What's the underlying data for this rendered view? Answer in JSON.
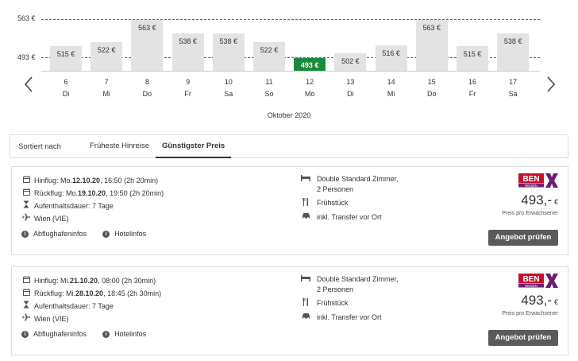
{
  "chart": {
    "y_labels": {
      "high": "563 €",
      "low": "493 €"
    },
    "month": "Oktober 2020",
    "selected_index": 6,
    "bars": [
      {
        "price_label": "515 €",
        "value": 515,
        "day": "6",
        "weekday": "Di"
      },
      {
        "price_label": "522 €",
        "value": 522,
        "day": "7",
        "weekday": "Mi"
      },
      {
        "price_label": "563 €",
        "value": 563,
        "day": "8",
        "weekday": "Do"
      },
      {
        "price_label": "538 €",
        "value": 538,
        "day": "9",
        "weekday": "Fr"
      },
      {
        "price_label": "538 €",
        "value": 538,
        "day": "10",
        "weekday": "Sa"
      },
      {
        "price_label": "522 €",
        "value": 522,
        "day": "11",
        "weekday": "So"
      },
      {
        "price_label": "493 €",
        "value": 493,
        "day": "12",
        "weekday": "Mo"
      },
      {
        "price_label": "502 €",
        "value": 502,
        "day": "13",
        "weekday": "Di"
      },
      {
        "price_label": "516 €",
        "value": 516,
        "day": "14",
        "weekday": "Mi"
      },
      {
        "price_label": "563 €",
        "value": 563,
        "day": "15",
        "weekday": "Do"
      },
      {
        "price_label": "515 €",
        "value": 515,
        "day": "16",
        "weekday": "Fr"
      },
      {
        "price_label": "538 €",
        "value": 538,
        "day": "17",
        "weekday": "Sa"
      }
    ],
    "prev_icon": "chevron-left-icon",
    "next_icon": "chevron-right-icon"
  },
  "sort": {
    "label": "Sortiert nach",
    "options": [
      "Früheste Hinreise",
      "Günstigster Preis"
    ],
    "active": 1
  },
  "offers": [
    {
      "outbound_prefix": "Hinflug: Mo. ",
      "outbound_date": "12.10.20",
      "outbound_suffix": ", 16:50 (2h 20min)",
      "return_prefix": "Rückflug: Mo. ",
      "return_date": "19.10.20",
      "return_suffix": ", 19:50 (2h 20min)",
      "stay": "Aufenthaltsdauer: 7 Tage",
      "airport": "Wien (VIE)",
      "room_line1": "Double Standard Zimmer,",
      "room_line2": "2 Personen",
      "board": "Frühstück",
      "transfer": "inkl. Transfer vor Ort",
      "brand_top": "BEN",
      "brand_sub": "REISEN",
      "price": "493,-",
      "currency": "€",
      "price_note": "Preis pro Erwachsener",
      "cta": "Angebot prüfen",
      "airport_info": "Abflughafeninfos",
      "hotel_info": "Hotelinfos"
    },
    {
      "outbound_prefix": "Hinflug: Mi. ",
      "outbound_date": "21.10.20",
      "outbound_suffix": ", 08:00 (2h 30min)",
      "return_prefix": "Rückflug: Mi. ",
      "return_date": "28.10.20",
      "return_suffix": ", 18:45 (2h 30min)",
      "stay": "Aufenthaltsdauer: 7 Tage",
      "airport": "Wien (VIE)",
      "room_line1": "Double Standard Zimmer,",
      "room_line2": "2 Personen",
      "board": "Frühstück",
      "transfer": "inkl. Transfer vor Ort",
      "brand_top": "BEN",
      "brand_sub": "REISEN",
      "price": "493,-",
      "currency": "€",
      "price_note": "Preis pro Erwachsener",
      "cta": "Angebot prüfen",
      "airport_info": "Abflughafeninfos",
      "hotel_info": "Hotelinfos"
    }
  ],
  "colors": {
    "selected_bar": "#1a8a3d",
    "bar": "#e3e3e3",
    "button": "#5a5a5a",
    "brand_red": "#c8102e",
    "brand_purple": "#6b1f6e"
  }
}
